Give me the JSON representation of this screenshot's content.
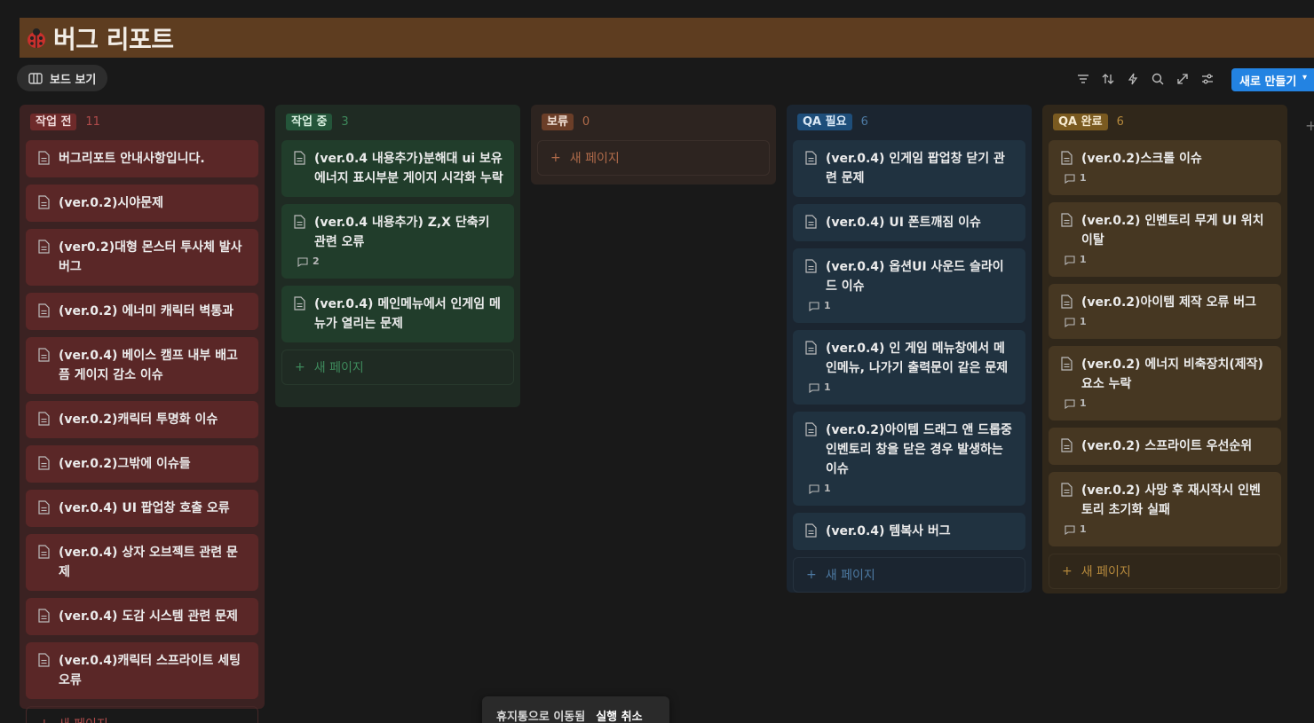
{
  "page": {
    "title": "버그 리포트"
  },
  "view": {
    "label": "보드 보기"
  },
  "toolbar": {
    "new_label": "새로 만들기"
  },
  "colors": {
    "accent": "#2383e2",
    "title_bg": "#5e3d20"
  },
  "columns": [
    {
      "name": "작업 전",
      "count": "11",
      "tag_bg": "#6e2a2a",
      "tag_color": "#f0dada",
      "count_color": "#b04b4b",
      "cards": [
        {
          "title": "버그리포트 안내사항입니다.",
          "comments": ""
        },
        {
          "title": "(ver.0.2)시야문제",
          "comments": ""
        },
        {
          "title": "(ver0.2)대형 몬스터 투사체 발사 버그",
          "comments": ""
        },
        {
          "title": "(ver.0.2) 에너미 캐릭터 벽통과",
          "comments": ""
        },
        {
          "title": "(ver.0.4) 베이스 캠프 내부 배고픔 게이지 감소 이슈",
          "comments": ""
        },
        {
          "title": "(ver.0.2)캐릭터 투명화 이슈",
          "comments": ""
        },
        {
          "title": "(ver.0.2)그밖에 이슈들",
          "comments": ""
        },
        {
          "title": "(ver.0.4) UI 팝업창 호출 오류",
          "comments": ""
        },
        {
          "title": "(ver.0.4) 상자 오브젝트 관련 문제",
          "comments": ""
        },
        {
          "title": "(ver.0.4) 도감 시스템 관련 문제",
          "comments": ""
        },
        {
          "title": "(ver.0.4)캐릭터 스프라이트 세팅 오류",
          "comments": ""
        }
      ],
      "new_page": "새 페이지"
    },
    {
      "name": "작업 중",
      "count": "3",
      "tag_bg": "#24553a",
      "tag_color": "#d8f0e0",
      "count_color": "#3e8a5c",
      "cards": [
        {
          "title": "(ver.0.4 내용추가)분해대 ui 보유 에너지 표시부분 게이지 시각화 누락",
          "comments": ""
        },
        {
          "title": "(ver.0.4 내용추가) Z,X 단축키 관련 오류",
          "comments": "2"
        },
        {
          "title": "(ver.0.4) 메인메뉴에서 인게임 메뉴가 열리는 문제",
          "comments": ""
        }
      ],
      "new_page": "새 페이지"
    },
    {
      "name": "보류",
      "count": "0",
      "tag_bg": "#6b3e28",
      "tag_color": "#f2e2d8",
      "count_color": "#b06b4a",
      "cards": [],
      "new_page": "새 페이지"
    },
    {
      "name": "QA 필요",
      "count": "6",
      "tag_bg": "#1e4e7a",
      "tag_color": "#dbe9f6",
      "count_color": "#4d7aa3",
      "cards": [
        {
          "title": "(ver.0.4) 인게임 팝업창 닫기 관련 문제",
          "comments": ""
        },
        {
          "title": "(ver.0.4) UI 폰트깨짐 이슈",
          "comments": ""
        },
        {
          "title": "(ver.0.4) 옵션UI 사운드 슬라이드 이슈",
          "comments": "1"
        },
        {
          "title": "(ver.0.4) 인 게임 메뉴창에서 메인메뉴, 나가기 출력문이 같은 문제",
          "comments": "1"
        },
        {
          "title": "(ver.0.2)아이템 드래그 앤 드롭중 인벤토리 창을 닫은 경우 발생하는 이슈",
          "comments": "1"
        },
        {
          "title": "(ver.0.4) 템복사 버그",
          "comments": ""
        }
      ],
      "new_page": "새 페이지"
    },
    {
      "name": "QA 완료",
      "count": "6",
      "tag_bg": "#7a5a20",
      "tag_color": "#f6ead0",
      "count_color": "#b5893c",
      "cards": [
        {
          "title": "(ver.0.2)스크롤 이슈",
          "comments": "1"
        },
        {
          "title": "(ver.0.2) 인벤토리 무게 UI 위치 이탈",
          "comments": "1"
        },
        {
          "title": "(ver.0.2)아이템 제작 오류 버그",
          "comments": "1"
        },
        {
          "title": "(ver.0.2) 에너지 비축장치(제작) 요소 누락",
          "comments": "1"
        },
        {
          "title": "(ver.0.2) 스프라이트 우선순위",
          "comments": ""
        },
        {
          "title": "(ver.0.2) 사망 후 재시작시 인벤토리 초기화 실패",
          "comments": "1"
        }
      ],
      "new_page": "새 페이지"
    }
  ],
  "toast": {
    "message": "휴지통으로 이동됨",
    "undo": "실행 취소"
  }
}
